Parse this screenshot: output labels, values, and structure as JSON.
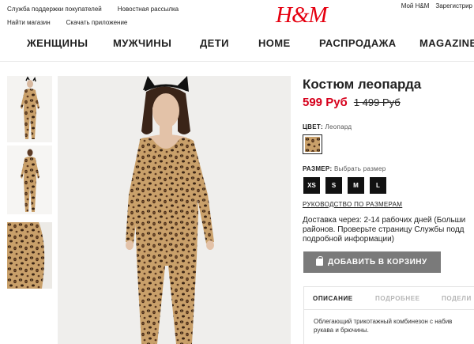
{
  "utility": {
    "support": "Служба поддержки покупателей",
    "newsletter": "Новостная рассылка",
    "find_store": "Найти магазин",
    "download_app": "Скачать приложение",
    "my_account": "Мой H&M",
    "register": "Зарегистрир"
  },
  "brand": {
    "logo": "H&M",
    "color": "#e50010"
  },
  "nav": {
    "items": [
      "ЖЕНЩИНЫ",
      "МУЖЧИНЫ",
      "ДЕТИ",
      "HOME",
      "РАСПРОДАЖА",
      "MAGAZINE"
    ]
  },
  "product": {
    "title": "Костюм леопарда",
    "price_new": "599 Руб",
    "price_old": "1 499 Руб",
    "color_label": "ЦВЕТ:",
    "color_value": "Леопард",
    "size_label": "РАЗМЕР:",
    "size_value": "Выбрать размер",
    "sizes": [
      "XS",
      "S",
      "M",
      "L"
    ],
    "size_guide": "РУКОВОДСТВО ПО РАЗМЕРАМ",
    "delivery_lines": [
      "Доставка через: 2-14 рабочих дней (Больши",
      "районов. Проверьте страницу Службы подд",
      "подробной информации)"
    ],
    "add_to_cart": "ДОБАВИТЬ В КОРЗИНУ"
  },
  "tabs": {
    "items": [
      "ОПИСАНИЕ",
      "ПОДРОБНЕЕ",
      "ПОДЕЛИ"
    ],
    "active": "ОПИСАНИЕ"
  },
  "description": {
    "lines": [
      "Облегающий трикотажный комбинезон с набив",
      "рукава и брючины."
    ]
  },
  "colors": {
    "price_sale": "#d6001c",
    "button_bg": "#7a7a7a"
  },
  "icons": [
    "bag-icon",
    "cat-ears"
  ]
}
